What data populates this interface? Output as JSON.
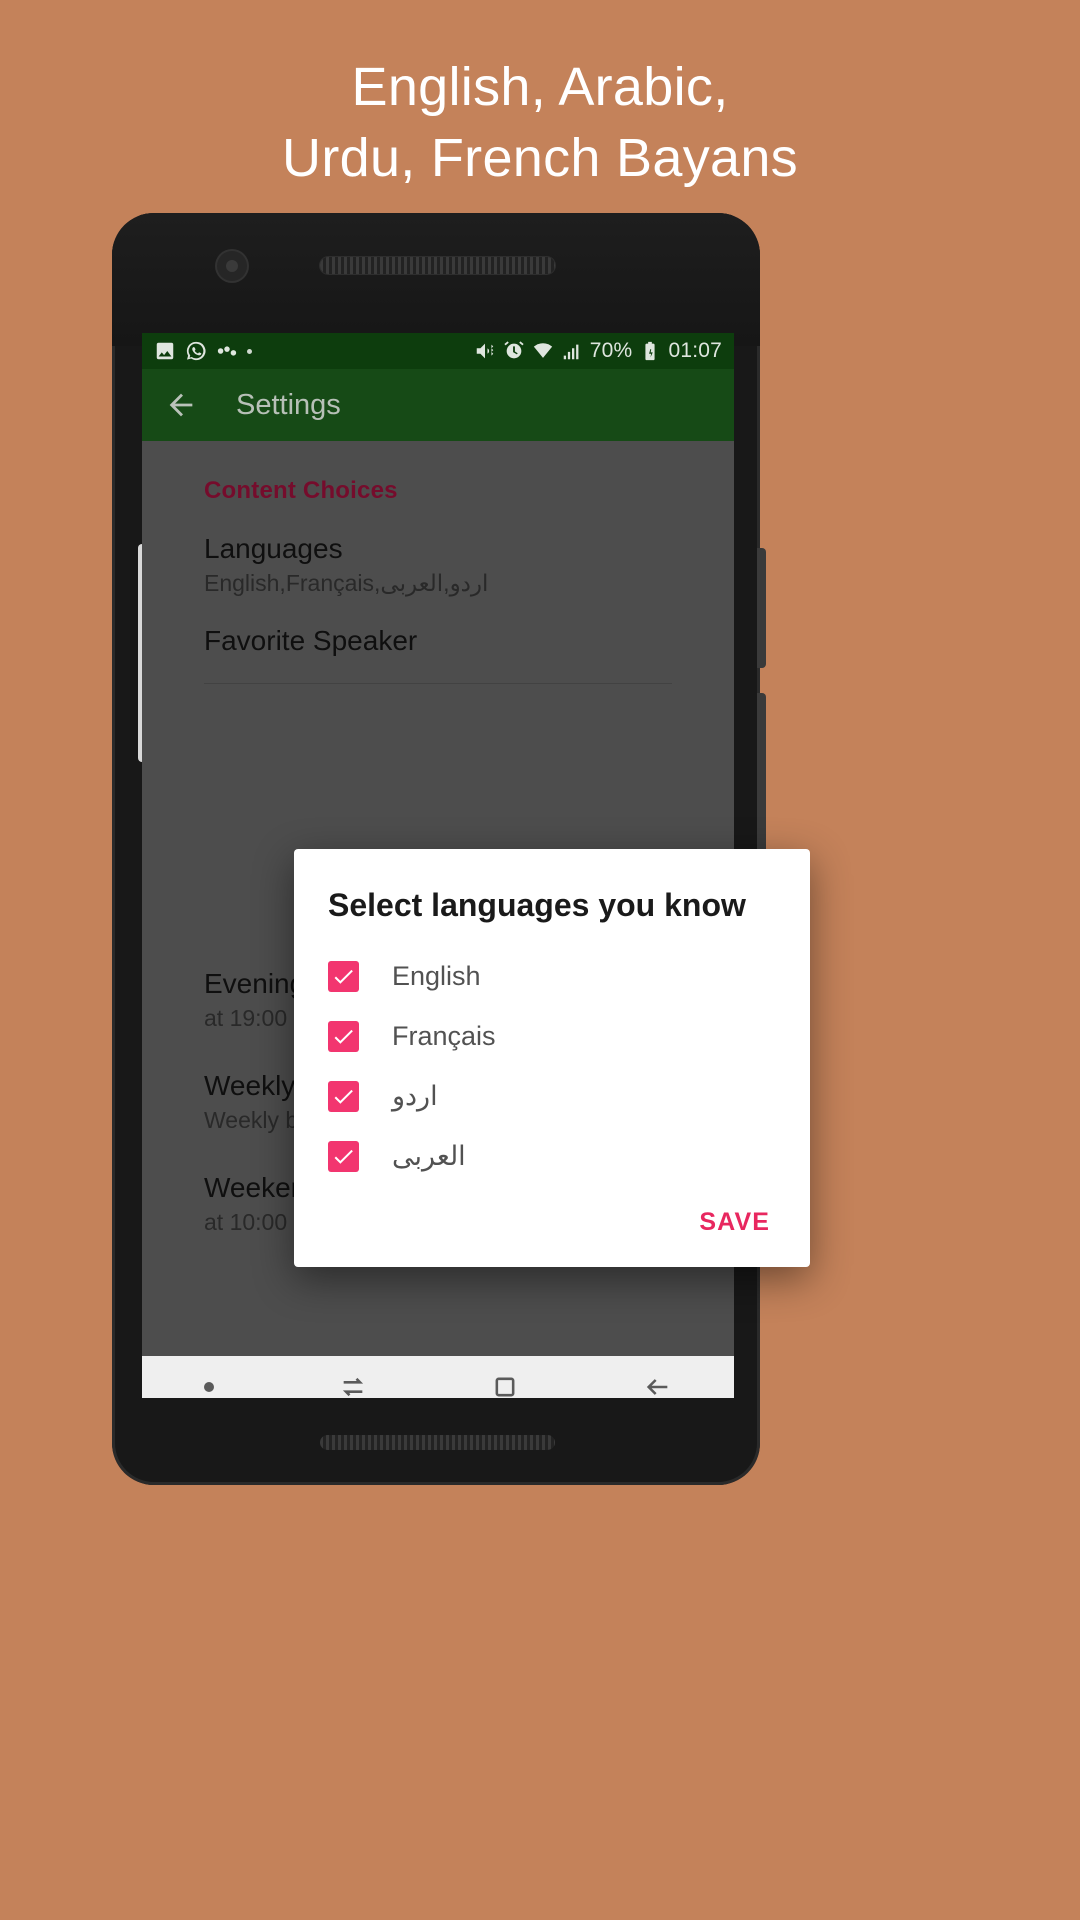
{
  "promo": {
    "headline_line1": "English, Arabic,",
    "headline_line2": "Urdu, French Bayans",
    "background_color": "#c4825a",
    "headline_color": "#ffffff"
  },
  "status_bar": {
    "left_icons": [
      "image-icon",
      "whatsapp-icon",
      "sync-icon",
      "dot-icon"
    ],
    "right_icons": [
      "mute-vibrate-icon",
      "alarm-icon",
      "wifi-icon",
      "signal-icon"
    ],
    "battery_percent": "70%",
    "battery_icon": "battery-charging-icon",
    "time": "01:07",
    "background_color": "#0d3d0d"
  },
  "app_bar": {
    "back_icon": "arrow-left-icon",
    "title": "Settings",
    "background_color": "#164a16"
  },
  "settings": {
    "section_header": "Content Choices",
    "section_header_color": "#a8123f",
    "rows": [
      {
        "title": "Languages",
        "subtitle": "English,Français,اردو,العربى",
        "has_checkbox": false
      },
      {
        "title": "Favorite Speaker",
        "subtitle": "",
        "has_checkbox": false
      },
      {
        "title": "Evening Time",
        "subtitle": "at 19:00",
        "has_checkbox": false
      },
      {
        "title": "Weekly Bayan",
        "subtitle": "Weekly bayan notification",
        "has_checkbox": true
      },
      {
        "title": "Weekend Time",
        "subtitle": "at 10:00",
        "has_checkbox": false
      }
    ]
  },
  "dialog": {
    "title": "Select languages you know",
    "items": [
      {
        "label": "English",
        "checked": true,
        "rtl": false
      },
      {
        "label": "Français",
        "checked": true,
        "rtl": false
      },
      {
        "label": "اردو",
        "checked": true,
        "rtl": true
      },
      {
        "label": "العربى",
        "checked": true,
        "rtl": true
      }
    ],
    "save_label": "SAVE",
    "accent_color": "#f2356f",
    "save_color": "#e8275f"
  },
  "nav_bar": {
    "items": [
      "dot-icon",
      "switch-keyboard-icon",
      "recents-square-icon",
      "back-arrow-icon"
    ],
    "background_color": "#efefef"
  }
}
